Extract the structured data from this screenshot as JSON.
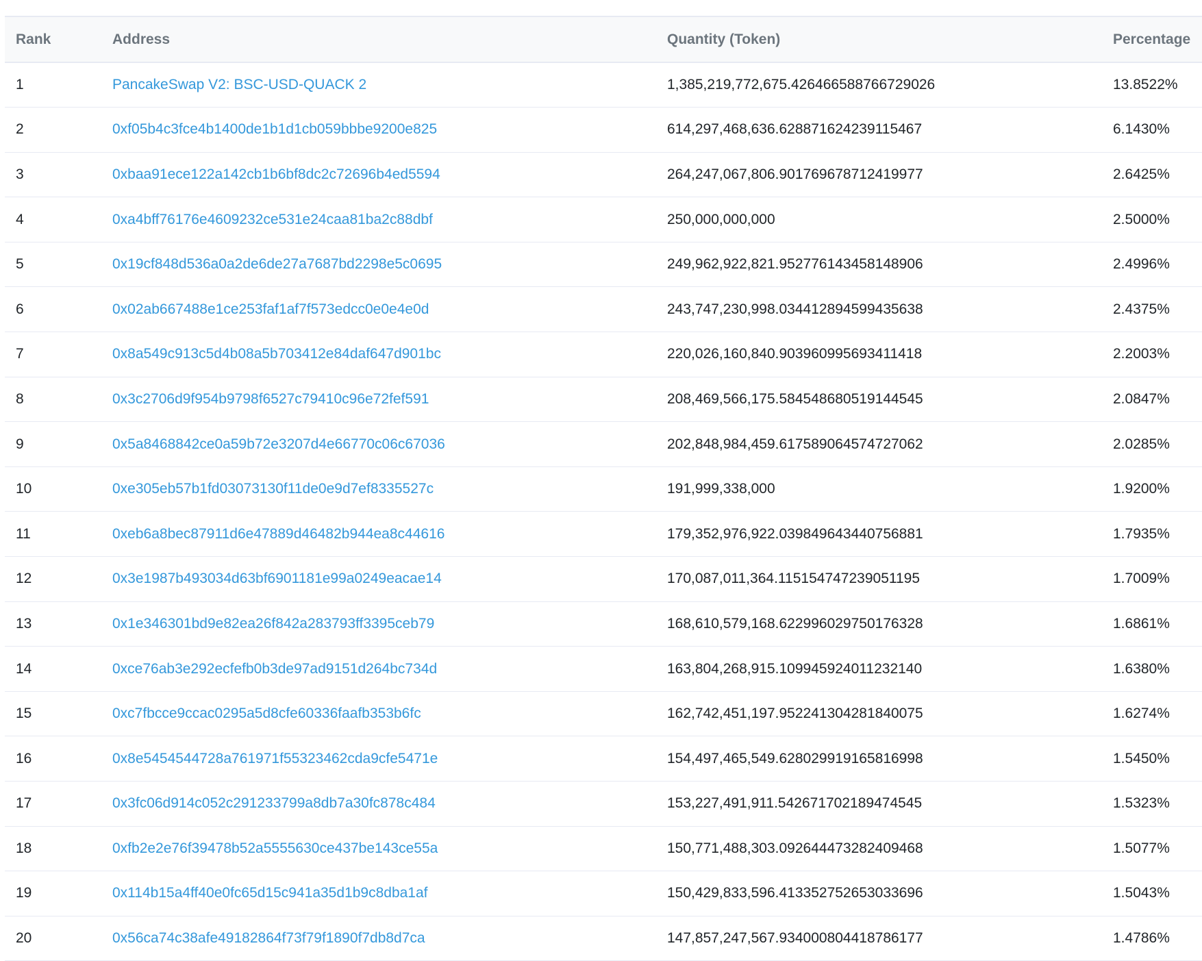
{
  "table": {
    "headers": {
      "rank": "Rank",
      "address": "Address",
      "quantity": "Quantity (Token)",
      "percentage": "Percentage"
    },
    "rows": [
      {
        "rank": "1",
        "address": "PancakeSwap V2: BSC-USD-QUACK 2",
        "quantity": "1,385,219,772,675.426466588766729026",
        "percentage": "13.8522%"
      },
      {
        "rank": "2",
        "address": "0xf05b4c3fce4b1400de1b1d1cb059bbbe9200e825",
        "quantity": "614,297,468,636.628871624239115467",
        "percentage": "6.1430%"
      },
      {
        "rank": "3",
        "address": "0xbaa91ece122a142cb1b6bf8dc2c72696b4ed5594",
        "quantity": "264,247,067,806.901769678712419977",
        "percentage": "2.6425%"
      },
      {
        "rank": "4",
        "address": "0xa4bff76176e4609232ce531e24caa81ba2c88dbf",
        "quantity": "250,000,000,000",
        "percentage": "2.5000%"
      },
      {
        "rank": "5",
        "address": "0x19cf848d536a0a2de6de27a7687bd2298e5c0695",
        "quantity": "249,962,922,821.952776143458148906",
        "percentage": "2.4996%"
      },
      {
        "rank": "6",
        "address": "0x02ab667488e1ce253faf1af7f573edcc0e0e4e0d",
        "quantity": "243,747,230,998.034412894599435638",
        "percentage": "2.4375%"
      },
      {
        "rank": "7",
        "address": "0x8a549c913c5d4b08a5b703412e84daf647d901bc",
        "quantity": "220,026,160,840.903960995693411418",
        "percentage": "2.2003%"
      },
      {
        "rank": "8",
        "address": "0x3c2706d9f954b9798f6527c79410c96e72fef591",
        "quantity": "208,469,566,175.584548680519144545",
        "percentage": "2.0847%"
      },
      {
        "rank": "9",
        "address": "0x5a8468842ce0a59b72e3207d4e66770c06c67036",
        "quantity": "202,848,984,459.617589064574727062",
        "percentage": "2.0285%"
      },
      {
        "rank": "10",
        "address": "0xe305eb57b1fd03073130f11de0e9d7ef8335527c",
        "quantity": "191,999,338,000",
        "percentage": "1.9200%"
      },
      {
        "rank": "11",
        "address": "0xeb6a8bec87911d6e47889d46482b944ea8c44616",
        "quantity": "179,352,976,922.039849643440756881",
        "percentage": "1.7935%"
      },
      {
        "rank": "12",
        "address": "0x3e1987b493034d63bf6901181e99a0249eacae14",
        "quantity": "170,087,011,364.115154747239051195",
        "percentage": "1.7009%"
      },
      {
        "rank": "13",
        "address": "0x1e346301bd9e82ea26f842a283793ff3395ceb79",
        "quantity": "168,610,579,168.622996029750176328",
        "percentage": "1.6861%"
      },
      {
        "rank": "14",
        "address": "0xce76ab3e292ecfefb0b3de97ad9151d264bc734d",
        "quantity": "163,804,268,915.109945924011232140",
        "percentage": "1.6380%"
      },
      {
        "rank": "15",
        "address": "0xc7fbcce9ccac0295a5d8cfe60336faafb353b6fc",
        "quantity": "162,742,451,197.952241304281840075",
        "percentage": "1.6274%"
      },
      {
        "rank": "16",
        "address": "0x8e5454544728a761971f55323462cda9cfe5471e",
        "quantity": "154,497,465,549.628029919165816998",
        "percentage": "1.5450%"
      },
      {
        "rank": "17",
        "address": "0x3fc06d914c052c291233799a8db7a30fc878c484",
        "quantity": "153,227,491,911.542671702189474545",
        "percentage": "1.5323%"
      },
      {
        "rank": "18",
        "address": "0xfb2e2e76f39478b52a5555630ce437be143ce55a",
        "quantity": "150,771,488,303.092644473282409468",
        "percentage": "1.5077%"
      },
      {
        "rank": "19",
        "address": "0x114b15a4ff40e0fc65d15c941a35d1b9c8dba1af",
        "quantity": "150,429,833,596.413352752653033696",
        "percentage": "1.5043%"
      },
      {
        "rank": "20",
        "address": "0x56ca74c38afe49182864f73f79f1890f7db8d7ca",
        "quantity": "147,857,247,567.934000804418786177",
        "percentage": "1.4786%"
      }
    ]
  }
}
